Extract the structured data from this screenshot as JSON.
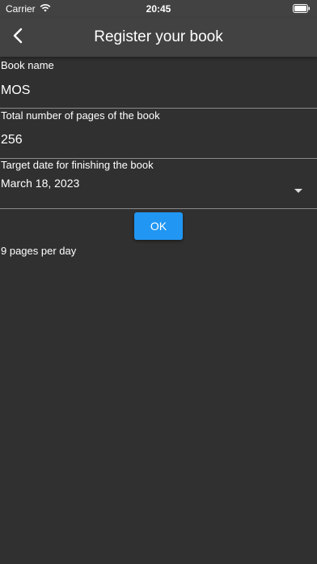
{
  "status_bar": {
    "carrier": "Carrier",
    "time": "20:45"
  },
  "app_bar": {
    "title": "Register your book",
    "back_icon": "chevron-left-icon"
  },
  "form": {
    "book_name": {
      "label": "Book name",
      "value": "MOS"
    },
    "total_pages": {
      "label": "Total number of pages of the book",
      "value": "256"
    },
    "target_date": {
      "label": "Target date for finishing the book",
      "value": "March 18, 2023"
    }
  },
  "ok_button": {
    "label": "OK"
  },
  "result": {
    "text": "9 pages per day"
  },
  "colors": {
    "background": "#303030",
    "app_bar": "#424242",
    "accent": "#2196f3"
  }
}
